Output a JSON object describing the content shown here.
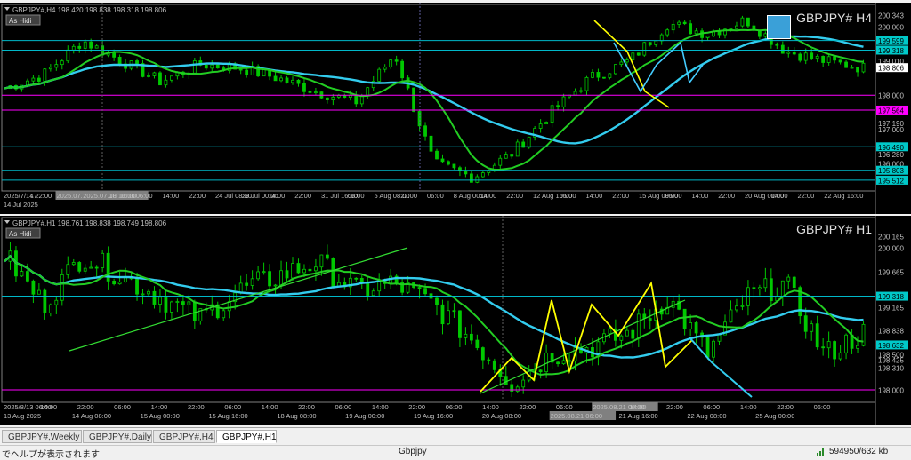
{
  "panels": [
    {
      "id": "h4",
      "info": "GBPJPY#,H4  198.420 198.838 198.318 198.806",
      "badge": "As Hidi",
      "symbol": "GBPJPY#  H4",
      "price_labels": [
        {
          "text": "200.343",
          "value": 200.343,
          "color": "#c0c0c0"
        },
        {
          "text": "200.000",
          "value": 200.0,
          "color": "#c0c0c0"
        },
        {
          "text": "199.599",
          "value": 199.599,
          "color": "#00c8c8"
        },
        {
          "text": "199.318",
          "value": 199.318,
          "color": "#00c8c8"
        },
        {
          "text": "199.010",
          "value": 199.01,
          "color": "#c0c0c0"
        },
        {
          "text": "198.806",
          "value": 198.806,
          "color": "#ffffff"
        },
        {
          "text": "198.000",
          "value": 198.0,
          "color": "#c0c0c0"
        },
        {
          "text": "197.564",
          "value": 197.564,
          "color": "#ff00ff"
        },
        {
          "text": "197.190",
          "value": 197.19,
          "color": "#c0c0c0"
        },
        {
          "text": "197.000",
          "value": 197.0,
          "color": "#c0c0c0"
        },
        {
          "text": "196.490",
          "value": 196.49,
          "color": "#00c8c8"
        },
        {
          "text": "196.280",
          "value": 196.28,
          "color": "#c0c0c0"
        },
        {
          "text": "196.000",
          "value": 196.0,
          "color": "#c0c0c0"
        },
        {
          "text": "195.803",
          "value": 195.803,
          "color": "#00c8c8"
        },
        {
          "text": "195.512",
          "value": 195.512,
          "color": "#00c8c8"
        }
      ],
      "time_labels": [
        "2025/7/14 22:00",
        "17",
        "2025.07.18 22:00",
        "2025.07.18 16:00",
        "Jul 16:00",
        "06:00",
        "14:00",
        "22:00",
        "24 Jul 08:00",
        "29 Jul 00:00",
        "14:00",
        "22:00",
        "31 Jul 16:00",
        "06:00",
        "5 Aug 08:00",
        "22:00",
        "06:00",
        "8 Aug 00:00",
        "14:00",
        "22:00",
        "12 Aug 16:00",
        "06:00",
        "14:00",
        "22:00",
        "15 Aug 08:00",
        "06:00",
        "14:00",
        "22:00",
        "20 Aug 00:00",
        "14:00",
        "22:00",
        "22 Aug 16:00"
      ],
      "time_row2": [
        "14 Jul 2025"
      ]
    },
    {
      "id": "h1",
      "info": "GBPJPY#,H1  198.761 198.838 198.749 198.806",
      "badge": "As Hidi",
      "symbol": "GBPJPY#  H1",
      "price_labels": [
        {
          "text": "200.165",
          "value": 200.165,
          "color": "#c0c0c0"
        },
        {
          "text": "200.000",
          "value": 200.0,
          "color": "#c0c0c0"
        },
        {
          "text": "199.665",
          "value": 199.665,
          "color": "#c0c0c0"
        },
        {
          "text": "199.318",
          "value": 199.318,
          "color": "#00c8c8"
        },
        {
          "text": "199.165",
          "value": 199.165,
          "color": "#c0c0c0"
        },
        {
          "text": "198.838",
          "value": 198.838,
          "color": "#c0c0c0"
        },
        {
          "text": "198.632",
          "value": 198.632,
          "color": "#00c8c8"
        },
        {
          "text": "198.500",
          "value": 198.5,
          "color": "#c0c0c0"
        },
        {
          "text": "198.425",
          "value": 198.425,
          "color": "#c0c0c0"
        },
        {
          "text": "198.310",
          "value": 198.31,
          "color": "#c0c0c0"
        },
        {
          "text": "198.000",
          "value": 198.0,
          "color": "#c0c0c0"
        }
      ],
      "time_labels": [
        "2025/8/13 06:00",
        "14:00",
        "22:00",
        "06:00",
        "14:00",
        "22:00",
        "06:00",
        "14:00",
        "22:00",
        "06:00",
        "14:00",
        "22:00",
        "06:00",
        "14:00",
        "22:00",
        "06:00",
        "2025.08.21 06:00",
        "14:00",
        "22:00",
        "06:00",
        "14:00",
        "22:00",
        "06:00"
      ],
      "time_row2": [
        "13 Aug 2025",
        "14 Aug 08:00",
        "15 Aug 00:00",
        "15 Aug 16:00",
        "18 Aug 08:00",
        "19 Aug 00:00",
        "19 Aug 16:00",
        "20 Aug 08:00",
        "2025.08.21 06:00",
        "21 Aug 16:00",
        "22 Aug 08:00",
        "25 Aug 00:00"
      ]
    }
  ],
  "tabs": [
    {
      "label": "GBPJPY#,Weekly",
      "active": false
    },
    {
      "label": "GBPJPY#,Daily",
      "active": false
    },
    {
      "label": "GBPJPY#,H4",
      "active": false
    },
    {
      "label": "GBPJPY#,H1",
      "active": true
    }
  ],
  "status": {
    "help": "でヘルプが表示されます",
    "profile": "Gbpjpy",
    "traffic": "594950/632 kb"
  },
  "colors": {
    "bg": "#000000",
    "candle": "#00c800",
    "ma_fast": "#22cc22",
    "ma_slow": "#33ccee",
    "magenta": "#ff00ff",
    "cyan_line": "#00b8c8",
    "yellow": "#ffff00",
    "trend": "#33dd33"
  }
}
